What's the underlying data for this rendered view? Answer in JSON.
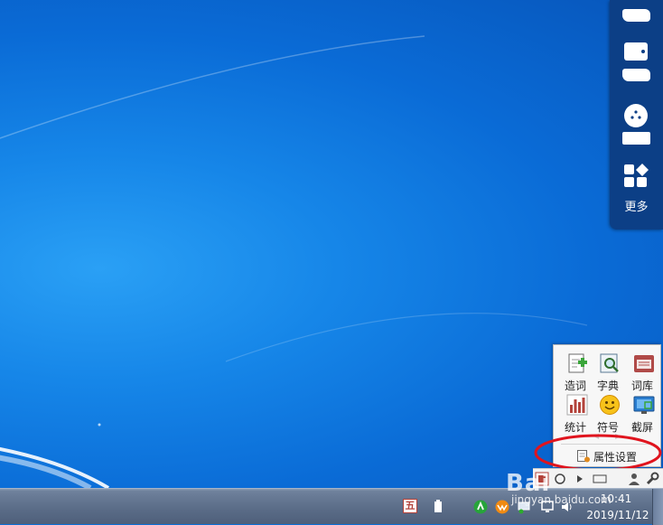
{
  "side_panel": {
    "more_label": "更多",
    "icons": [
      "hidden-app-icon",
      "hidden-app-icon",
      "hidden-app-icon",
      "more-grid-icon"
    ]
  },
  "ime_menu": {
    "tools": [
      {
        "label": "造词",
        "icon": "add-word-icon"
      },
      {
        "label": "字典",
        "icon": "dictionary-icon"
      },
      {
        "label": "词库",
        "icon": "word-library-icon"
      },
      {
        "label": "统计",
        "icon": "statistics-icon"
      },
      {
        "label": "符号",
        "icon": "emoji-symbol-icon"
      },
      {
        "label": "截屏",
        "icon": "screenshot-icon"
      }
    ],
    "settings_label": "属性设置",
    "highlight_color": "#e0141e"
  },
  "taskbar": {
    "ime_char": "五",
    "time": "10:41",
    "date": "2019/11/12"
  },
  "watermark": {
    "brand": "Bai",
    "url": "jingyan.baidu.com"
  },
  "colors": {
    "desktop": "#0a6fd8",
    "panel": "#0c3f86",
    "accent": "#0c3f86"
  }
}
